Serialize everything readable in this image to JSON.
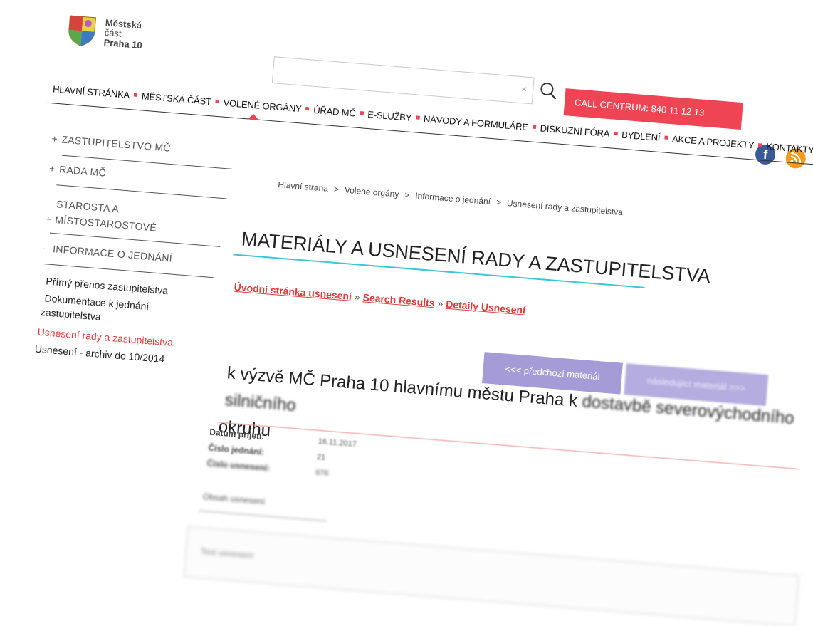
{
  "header": {
    "logo_lines": [
      "Městská",
      "část",
      "Praha 10"
    ],
    "search": {
      "placeholder": "",
      "clear_glyph": "×",
      "button_icon": "search-icon"
    },
    "call_centrum": "CALL CENTRUM: 840 11 12 13",
    "social": {
      "facebook_glyph": "f",
      "rss": "rss-icon"
    }
  },
  "nav": {
    "items": [
      "HLAVNÍ STRÁNKA",
      "MĚSTSKÁ ČÁST",
      "VOLENÉ ORGÁNY",
      "ÚŘAD MČ",
      "E-SLUŽBY",
      "NÁVODY A FORMULÁŘE",
      "DISKUZNÍ FÓRA",
      "BYDLENÍ",
      "AKCE A PROJEKTY",
      "KONTAKTY"
    ],
    "active": "VOLENÉ ORGÁNY"
  },
  "sidebar": {
    "sections": [
      {
        "marker": "+",
        "label": "ZASTUPITELSTVO MČ"
      },
      {
        "marker": "+",
        "label": "RADA MČ"
      },
      {
        "marker": "+",
        "label_lines": [
          "STAROSTA A",
          "MÍSTOSTAROSTOVÉ"
        ]
      },
      {
        "marker": "-",
        "label": "INFORMACE O JEDNÁNÍ"
      }
    ],
    "sub_items": [
      {
        "label": "Přímý přenos zastupitelstva",
        "active": false
      },
      {
        "label_lines": [
          "Dokumentace k jednání",
          "zastupitelstva"
        ],
        "active": false
      },
      {
        "label": "Usnesení rady a zastupitelstva",
        "active": true
      },
      {
        "label": "Usnesení - archiv do 10/2014",
        "active": false
      }
    ]
  },
  "breadcrumb": [
    "Hlavní strana",
    "Volené orgány",
    "Informace o jednání",
    "Usnesení rady a zastupitelstva"
  ],
  "breadcrumb_separator": ">",
  "page_title": "MATERIÁLY A USNESENÍ RADY A ZASTUPITELSTVA",
  "sublinks": {
    "items": [
      "Úvodní stránka usnesení",
      "Search Results",
      "Detaily Usnesení"
    ],
    "separator": "»"
  },
  "pager": {
    "prev": "<<< předchozí materiál",
    "next": "následující materiál >>>"
  },
  "resolution": {
    "title_line1_clear": "k výzvě MČ Praha 10 hlavnímu městu Praha k ",
    "title_line1_blur": "dostavbě severovýchodního silničního",
    "title_line2": "okruhu"
  },
  "meta": [
    {
      "label": "Datum přijetí:",
      "value": "16.11.2017"
    },
    {
      "label": "Číslo jednání:",
      "value": "21"
    },
    {
      "label": "Číslo usnesení:",
      "value": "676"
    }
  ],
  "section_label": "Obsah usnesení",
  "text_box_hint": "Text usnesení",
  "colors": {
    "accent_red": "#ef4453",
    "title_rule": "#39c6d6",
    "pager": "#a59bd6",
    "link_red": "#e23a3a"
  }
}
